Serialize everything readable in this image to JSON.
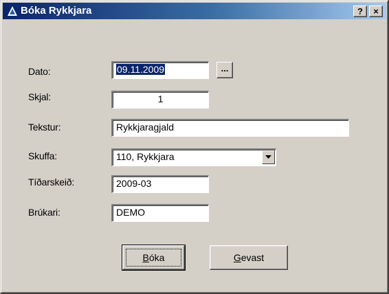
{
  "window": {
    "title": "Bóka Rykkjara",
    "help_button": "?",
    "close_button": "×"
  },
  "form": {
    "dato_label": "Dato:",
    "dato_value": "09.11.2009",
    "date_picker_button": "...",
    "skjal_label": "Skjal:",
    "skjal_value": "1",
    "tekstur_label": "Tekstur:",
    "tekstur_value": "Rykkjaragjald",
    "skuffa_label": "Skuffa:",
    "skuffa_value": "110, Rykkjara",
    "tidarskeid_label": "Tíðarskeið:",
    "tidarskeid_value": "2009-03",
    "brukari_label": "Brúkari:",
    "brukari_value": "DEMO"
  },
  "buttons": {
    "boka_first": "B",
    "boka_rest": "óka",
    "gevast_first": "G",
    "gevast_rest": "evast"
  },
  "colors": {
    "titlebar_start": "#0a246a",
    "titlebar_end": "#a6caf0",
    "dialog_bg": "#d4d0c8",
    "selection": "#0a246a"
  },
  "icons": {
    "title": "app-triangle-icon",
    "dropdown": "chevron-down-icon"
  }
}
